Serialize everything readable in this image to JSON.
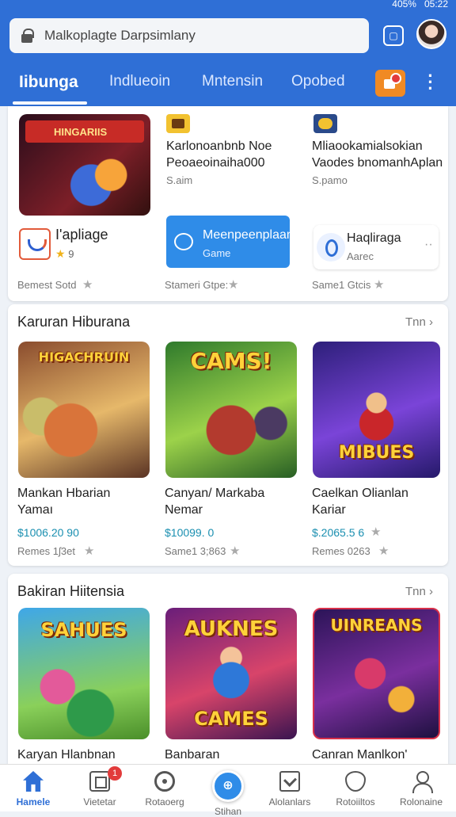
{
  "status_bar": {
    "battery": "405%",
    "time": "05:22"
  },
  "search": {
    "text": "Malkoplagte Darpsimlany"
  },
  "tabs": [
    {
      "label": "Iibunga"
    },
    {
      "label": "Indlueoin"
    },
    {
      "label": "Mntensin"
    },
    {
      "label": "Opobed"
    }
  ],
  "top_section": {
    "featured_banner": "HINGARIIS",
    "featured_app": {
      "name": "I'apliage",
      "rating": "9",
      "meta": "Bemest Sotd"
    },
    "items": [
      {
        "name_line1": "Karlonoanbnb Noe",
        "name_line2": "Peoaeoinaiha000",
        "sub": "S.aim",
        "meta": "Stameri Gtpe:"
      },
      {
        "name_line1": "Mliaookamialsokian",
        "name_line2": "Vaodes bnomanhAplan",
        "sub": "S.pamo",
        "meta": "Same1 Gtcis"
      }
    ],
    "chip": {
      "title": "Meenpeenplaan",
      "subtitle": "Game"
    },
    "side_app": {
      "name": "Haqliraga",
      "sub": "Aarec"
    }
  },
  "section1": {
    "title": "Karuran Hiburana",
    "see_all": "Tnn",
    "games": [
      {
        "art_title": "HIGACHRUIN",
        "name_line1": "Mankan Hbarian",
        "name_line2": "Yamaı",
        "price": "$1006.20 90",
        "meta": "Remes 1ʃ3et"
      },
      {
        "art_title": "CAMS!",
        "name_line1": "Canyan/ Markaba",
        "name_line2": "Nemar",
        "price": "$10099. 0",
        "meta": "Same1 3;863"
      },
      {
        "art_title": "MIBUES",
        "name_line1": "Caelkan Olianlan",
        "name_line2": "Kariar",
        "price": "$.2065.5 6",
        "meta": "Remes 0263"
      }
    ]
  },
  "section2": {
    "title": "Bakiran Hiitensia",
    "see_all": "Tnn",
    "games": [
      {
        "art_title": "SAHUES",
        "name": "Karyan Hlanbnan"
      },
      {
        "art_title": "AUKNES",
        "art_title2": "CAMES",
        "name": "Banbaran"
      },
      {
        "art_title": "UINREANS",
        "name": "Canran Manlkon'"
      }
    ]
  },
  "bottom_nav": [
    {
      "label": "Hamele",
      "icon": "home-icon"
    },
    {
      "label": "Vietetar",
      "icon": "apps-icon",
      "badge": "1"
    },
    {
      "label": "Rotaoerg",
      "icon": "search-icon"
    },
    {
      "label": "Stihan",
      "icon": "center-fab-icon"
    },
    {
      "label": "Alolanlars",
      "icon": "checkbox-icon"
    },
    {
      "label": "Rotoiiltos",
      "icon": "heart-icon"
    },
    {
      "label": "Rolonaine",
      "icon": "profile-icon"
    }
  ]
}
